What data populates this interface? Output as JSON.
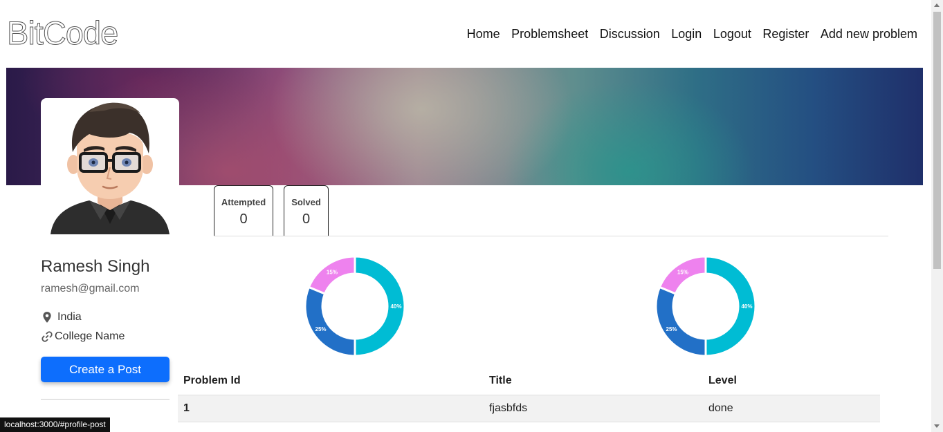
{
  "brand": {
    "logo": "BitCode"
  },
  "nav": {
    "items": [
      "Home",
      "Problemsheet",
      "Discussion",
      "Login",
      "Logout",
      "Register",
      "Add new problem"
    ]
  },
  "profile": {
    "name": "Ramesh Singh",
    "email": "ramesh@gmail.com",
    "location": "India",
    "college": "College Name",
    "location_icon": "map-pin-icon",
    "college_icon": "link-icon",
    "create_post_label": "Create a Post"
  },
  "stats": [
    {
      "label": "Attempted",
      "value": "0"
    },
    {
      "label": "Solved",
      "value": "0"
    }
  ],
  "chart_data": [
    {
      "type": "pie",
      "labels": [
        "40%",
        "25%",
        "15%"
      ],
      "values": [
        40,
        25,
        15
      ],
      "colors": [
        "#00bcd4",
        "#2270c7",
        "#ee82ee"
      ]
    },
    {
      "type": "pie",
      "labels": [
        "40%",
        "25%",
        "15%"
      ],
      "values": [
        40,
        25,
        15
      ],
      "colors": [
        "#00bcd4",
        "#2270c7",
        "#ee82ee"
      ]
    }
  ],
  "table": {
    "headers": [
      "Problem Id",
      "Title",
      "Level"
    ],
    "rows": [
      [
        "1",
        "fjasbfds",
        "done"
      ]
    ]
  },
  "status_bar": {
    "url": "localhost:3000/#profile-post"
  },
  "colors": {
    "primary": "#0d6efd",
    "accent": "#00bcd4"
  }
}
